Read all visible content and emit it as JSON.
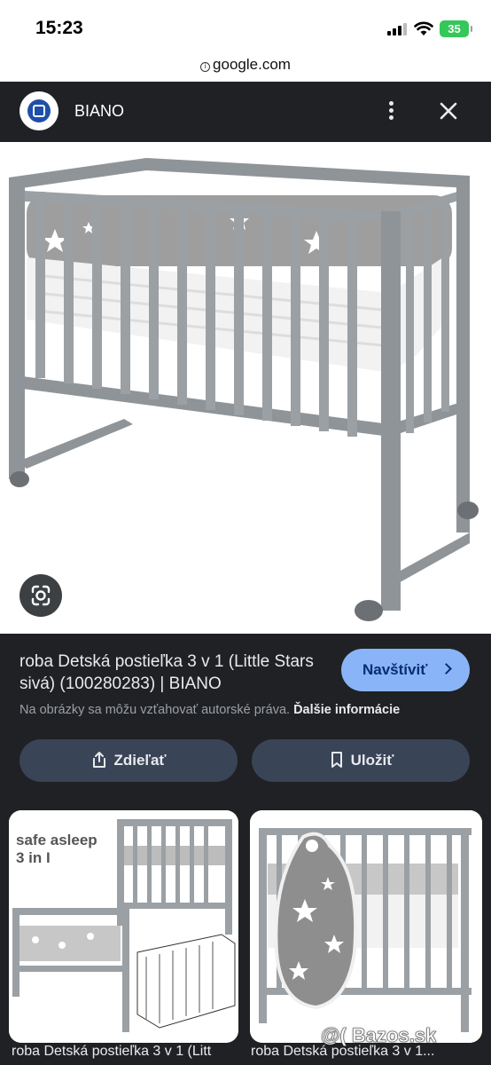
{
  "status": {
    "time": "15:23",
    "battery": "35"
  },
  "browser": {
    "url": "google.com"
  },
  "header": {
    "site_name": "BIANO"
  },
  "result": {
    "title": "roba Detská postieľka 3 v 1 (Little Stars sivá) (100280283) | BIANO",
    "visit_label": "Navštíviť",
    "copyright_notice": "Na obrázky sa môžu vzťahovať autorské práva.",
    "more_info": "Ďalšie informácie",
    "share_label": "Zdieľať",
    "save_label": "Uložiť"
  },
  "related": [
    {
      "caption": "roba Detská postieľka 3 v 1 (Litt",
      "overlay_line1": "safe asleep",
      "overlay_line2": "3 in I"
    },
    {
      "caption": "roba Detská postieľka 3 v 1..."
    }
  ],
  "watermark": "@( Bazos.sk",
  "colors": {
    "accent": "#8ab4f8",
    "background": "#202124",
    "button": "#394457"
  },
  "icons": [
    "signal-icon",
    "wifi-icon",
    "lock-icon",
    "more-vert-icon",
    "close-icon",
    "lens-icon",
    "chevron-right-icon",
    "share-icon",
    "bookmark-icon"
  ]
}
